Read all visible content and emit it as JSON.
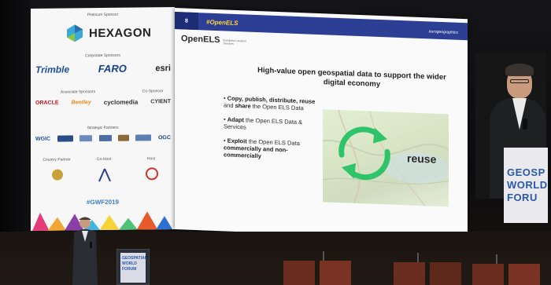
{
  "sponsor_screen": {
    "platinum_heading": "Platinum Sponsor",
    "platinum_logo": "HEXAGON",
    "corporate_heading": "Corporate Sponsors",
    "corporate_logos": [
      "Trimble",
      "FARO",
      "esri"
    ],
    "associate_heading": "Associate Sponsors",
    "cosponsor_heading": "Co-Sponsor",
    "associate_logos": [
      "ORACLE",
      "Bentley",
      "cyclomedia",
      "CYIENT"
    ],
    "strategic_heading": "Strategic Partners",
    "strategic_logos": [
      "WGIC",
      "OGC"
    ],
    "country_partner_heading": "Country Partner",
    "cohost_heading": "Co-Host",
    "host_heading": "Host",
    "hashtag": "#GWF2019"
  },
  "slide": {
    "number": "8",
    "hashtag": "#OpenELS",
    "brand_logo": "eurogeographics",
    "product_name": "OpenELS",
    "product_subtitle": "European Location Services",
    "title": "High-value open geospatial data to support the wider digital economy",
    "bullets": [
      {
        "strong": "Copy, publish, distribute, reuse",
        "rest_1": " and ",
        "strong_2": "share",
        "rest_2": " the Open ELS Data"
      },
      {
        "strong": "Adapt",
        "rest_1": " the Open ELS Data & Services",
        "strong_2": "",
        "rest_2": ""
      },
      {
        "strong": "Exploit",
        "rest_1": " the Open ELS Data ",
        "strong_2": "commercially and non-commercially",
        "rest_2": ""
      }
    ],
    "image_caption": "reuse"
  },
  "right_screen": {
    "lines": [
      "GEOSP",
      "WORLD",
      "FORU"
    ]
  },
  "podium": {
    "lines": [
      "GEOSPATIAL",
      "WORLD",
      "FORUM"
    ]
  },
  "colors": {
    "slide_bar": "#2c3f95",
    "hashtag_yellow": "#ffd23c",
    "recycle_green": "#2fc46a",
    "gwf_blue": "#2b59a8"
  }
}
